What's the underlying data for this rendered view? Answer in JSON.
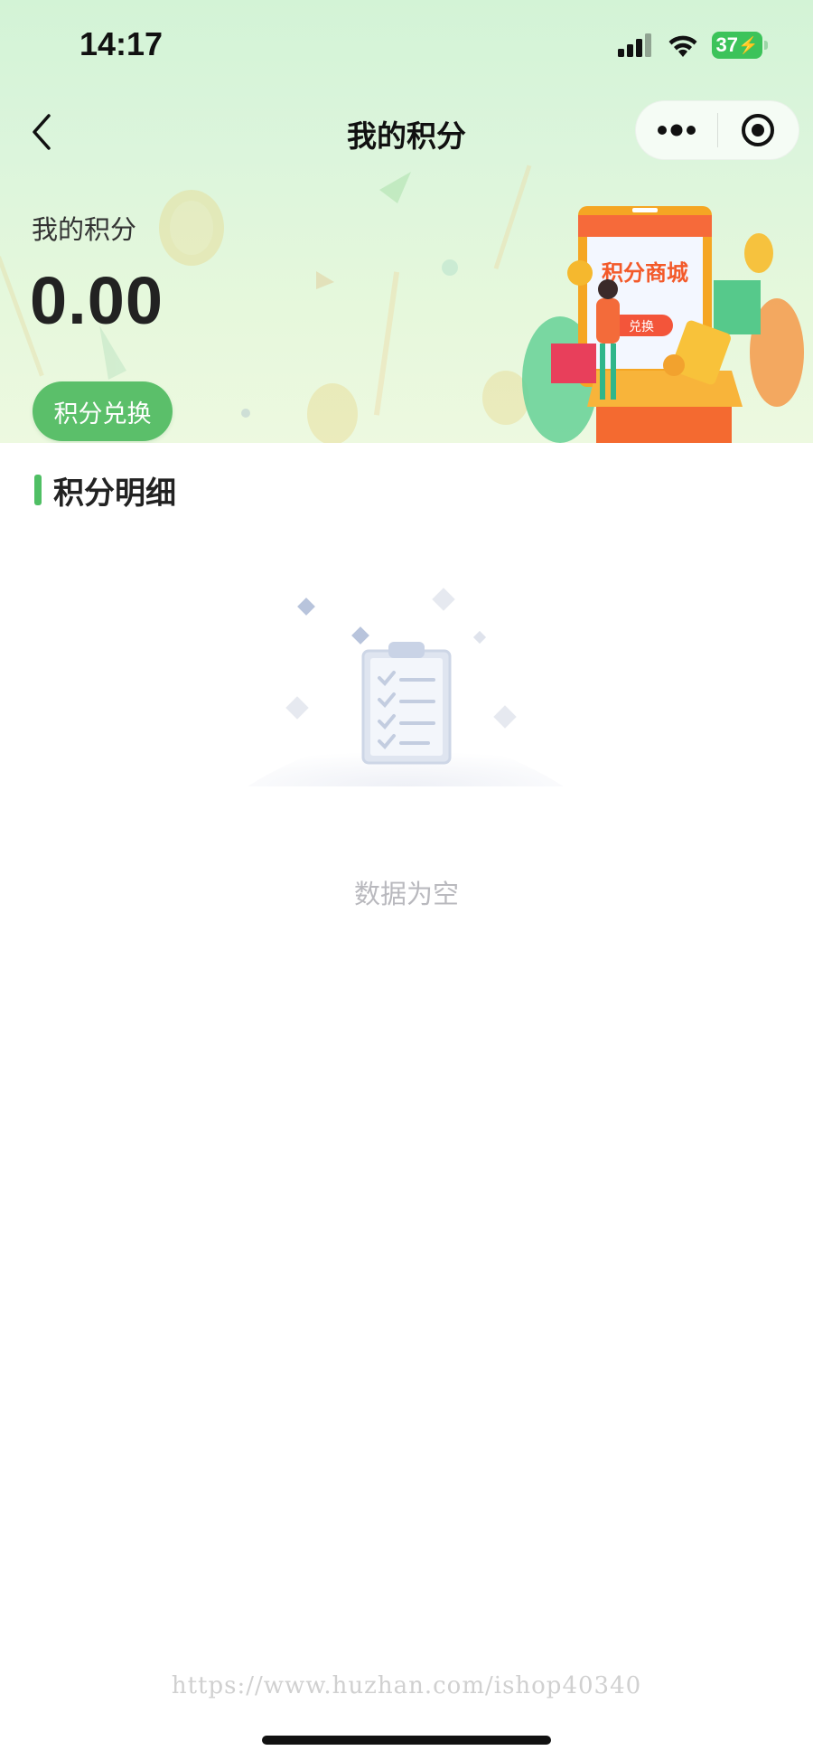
{
  "status_bar": {
    "time": "14:17",
    "battery": "37",
    "icons": [
      "cellular-signal-icon",
      "wifi-icon",
      "battery-charging-icon"
    ]
  },
  "nav": {
    "title": "我的积分",
    "back_icon": "chevron-left-icon",
    "menu_icon": "more-dots-icon",
    "close_icon": "target-circle-icon"
  },
  "points": {
    "label": "我的积分",
    "value": "0.00",
    "exchange_label": "积分兑换"
  },
  "mall_banner": {
    "title": "积分商城",
    "button": "兑换"
  },
  "detail": {
    "title": "积分明细",
    "empty_text": "数据为空"
  },
  "watermark": "https://www.huzhan.com/ishop40340",
  "colors": {
    "accent": "#5bbf6a",
    "header_bg": "#d3f3d6",
    "title_bar": "#4fbf64",
    "empty_text": "#b9b9be"
  }
}
